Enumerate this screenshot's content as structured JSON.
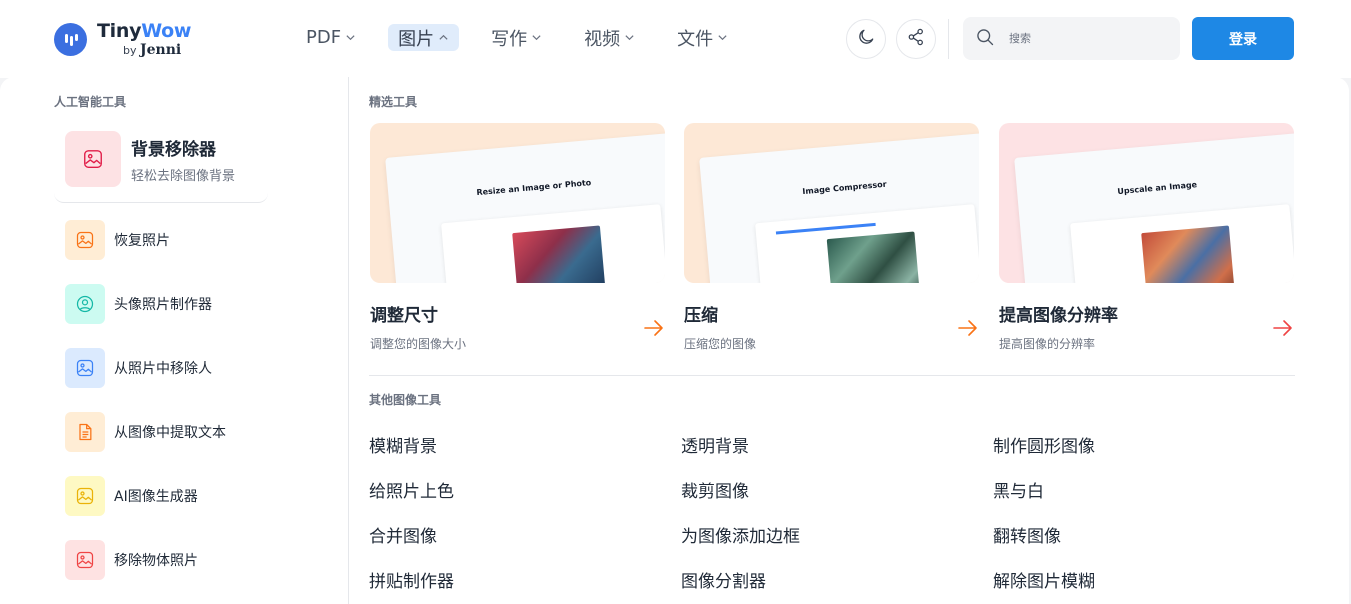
{
  "brand": {
    "name_part1": "Tiny",
    "name_part2": "Wow",
    "by": "by",
    "by_name": "Jenni"
  },
  "nav": [
    {
      "label": "PDF",
      "active": false
    },
    {
      "label": "图片",
      "active": true
    },
    {
      "label": "写作",
      "active": false
    },
    {
      "label": "视频",
      "active": false
    },
    {
      "label": "文件",
      "active": false
    }
  ],
  "search": {
    "placeholder": "搜索"
  },
  "login_label": "登录",
  "ai_section": {
    "title": "人工智能工具",
    "feature": {
      "title": "背景移除器",
      "subtitle": "轻松去除图像背景"
    },
    "items": [
      {
        "label": "恢复照片",
        "icon": "image-icon",
        "color": "#f97316",
        "bg": "#ffedd5"
      },
      {
        "label": "头像照片制作器",
        "icon": "user-icon",
        "color": "#14b8a6",
        "bg": "#ccfbf1"
      },
      {
        "label": "从照片中移除人",
        "icon": "image-icon",
        "color": "#3b82f6",
        "bg": "#dbeafe"
      },
      {
        "label": "从图像中提取文本",
        "icon": "document-icon",
        "color": "#f97316",
        "bg": "#ffedd5"
      },
      {
        "label": "AI图像生成器",
        "icon": "image-icon",
        "color": "#eab308",
        "bg": "#fef9c3"
      },
      {
        "label": "移除物体照片",
        "icon": "image-icon",
        "color": "#ef4444",
        "bg": "#fee2e2"
      }
    ]
  },
  "featured_section": {
    "title": "精选工具",
    "cards": [
      {
        "title": "调整尺寸",
        "subtitle": "调整您的图像大小",
        "mock_title": "Resize an Image or Photo",
        "bg": "#fde8d6",
        "arrow_color": "#f97316"
      },
      {
        "title": "压缩",
        "subtitle": "压缩您的图像",
        "mock_title": "Image Compressor",
        "bg": "#fde8d6",
        "arrow_color": "#f97316"
      },
      {
        "title": "提高图像分辨率",
        "subtitle": "提高图像的分辨率",
        "mock_title": "Upscale an Image",
        "bg": "#fde2e4",
        "arrow_color": "#ef4444"
      }
    ]
  },
  "other_section": {
    "title": "其他图像工具",
    "tools": [
      "模糊背景",
      "透明背景",
      "制作圆形图像",
      "给照片上色",
      "裁剪图像",
      "黑与白",
      "合并图像",
      "为图像添加边框",
      "翻转图像",
      "拼贴制作器",
      "图像分割器",
      "解除图片模糊"
    ]
  },
  "colors": {
    "accent": "#1e88e5",
    "brand": "#3b6fe0"
  }
}
